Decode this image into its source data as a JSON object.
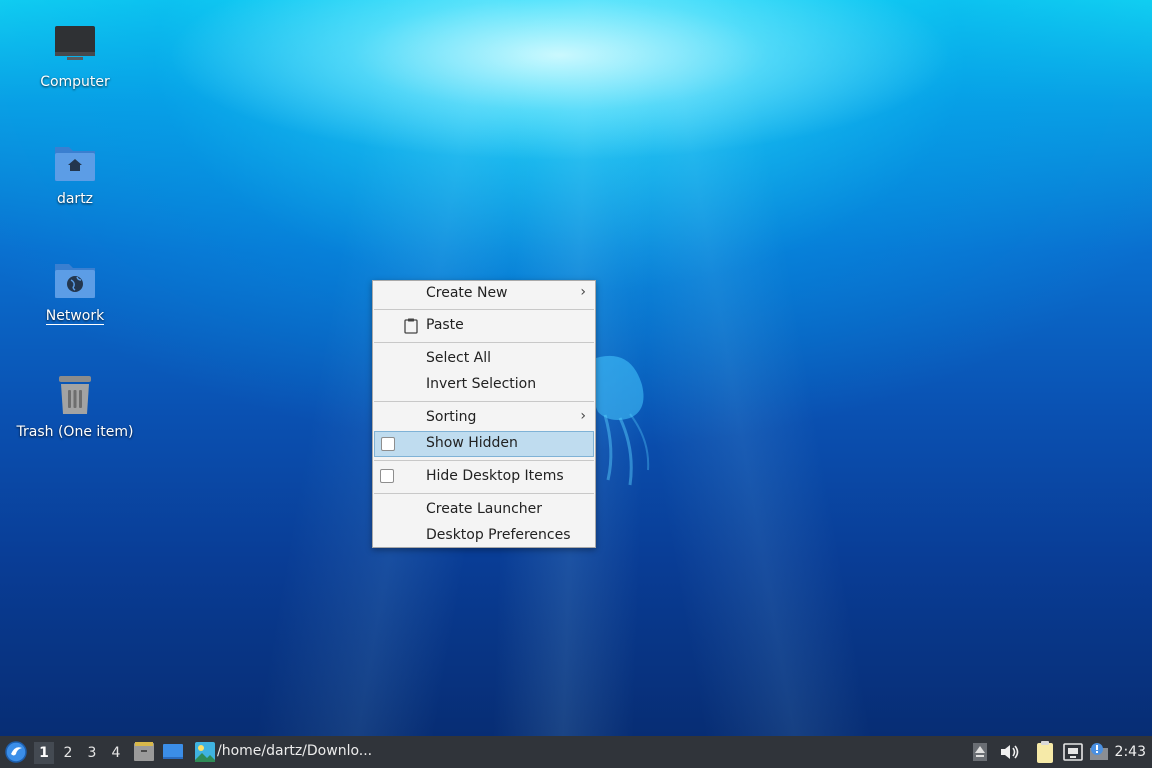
{
  "desktop": {
    "icons": [
      {
        "label": "Computer",
        "icon": "computer-icon"
      },
      {
        "label": "dartz",
        "icon": "home-folder-icon"
      },
      {
        "label": "Network",
        "icon": "network-folder-icon"
      },
      {
        "label": "Trash (One item)",
        "icon": "trash-icon"
      }
    ]
  },
  "context_menu": {
    "items": {
      "create_new": "Create New",
      "paste": "Paste",
      "select_all": "Select All",
      "invert_selection": "Invert Selection",
      "sorting": "Sorting",
      "show_hidden": "Show Hidden",
      "hide_desktop_items": "Hide Desktop Items",
      "create_launcher": "Create Launcher",
      "desktop_preferences": "Desktop Preferences"
    },
    "highlighted": "Show Hidden",
    "submenu_glyph": "›"
  },
  "taskbar": {
    "workspaces": [
      "1",
      "2",
      "3",
      "4"
    ],
    "active_workspace": "1",
    "task_title": "/home/dartz/Downlo...",
    "clock": "2:43",
    "background": "#30343a"
  },
  "colors": {
    "menu_highlight": "#bfdcef",
    "menu_background": "#f4f4f4"
  }
}
